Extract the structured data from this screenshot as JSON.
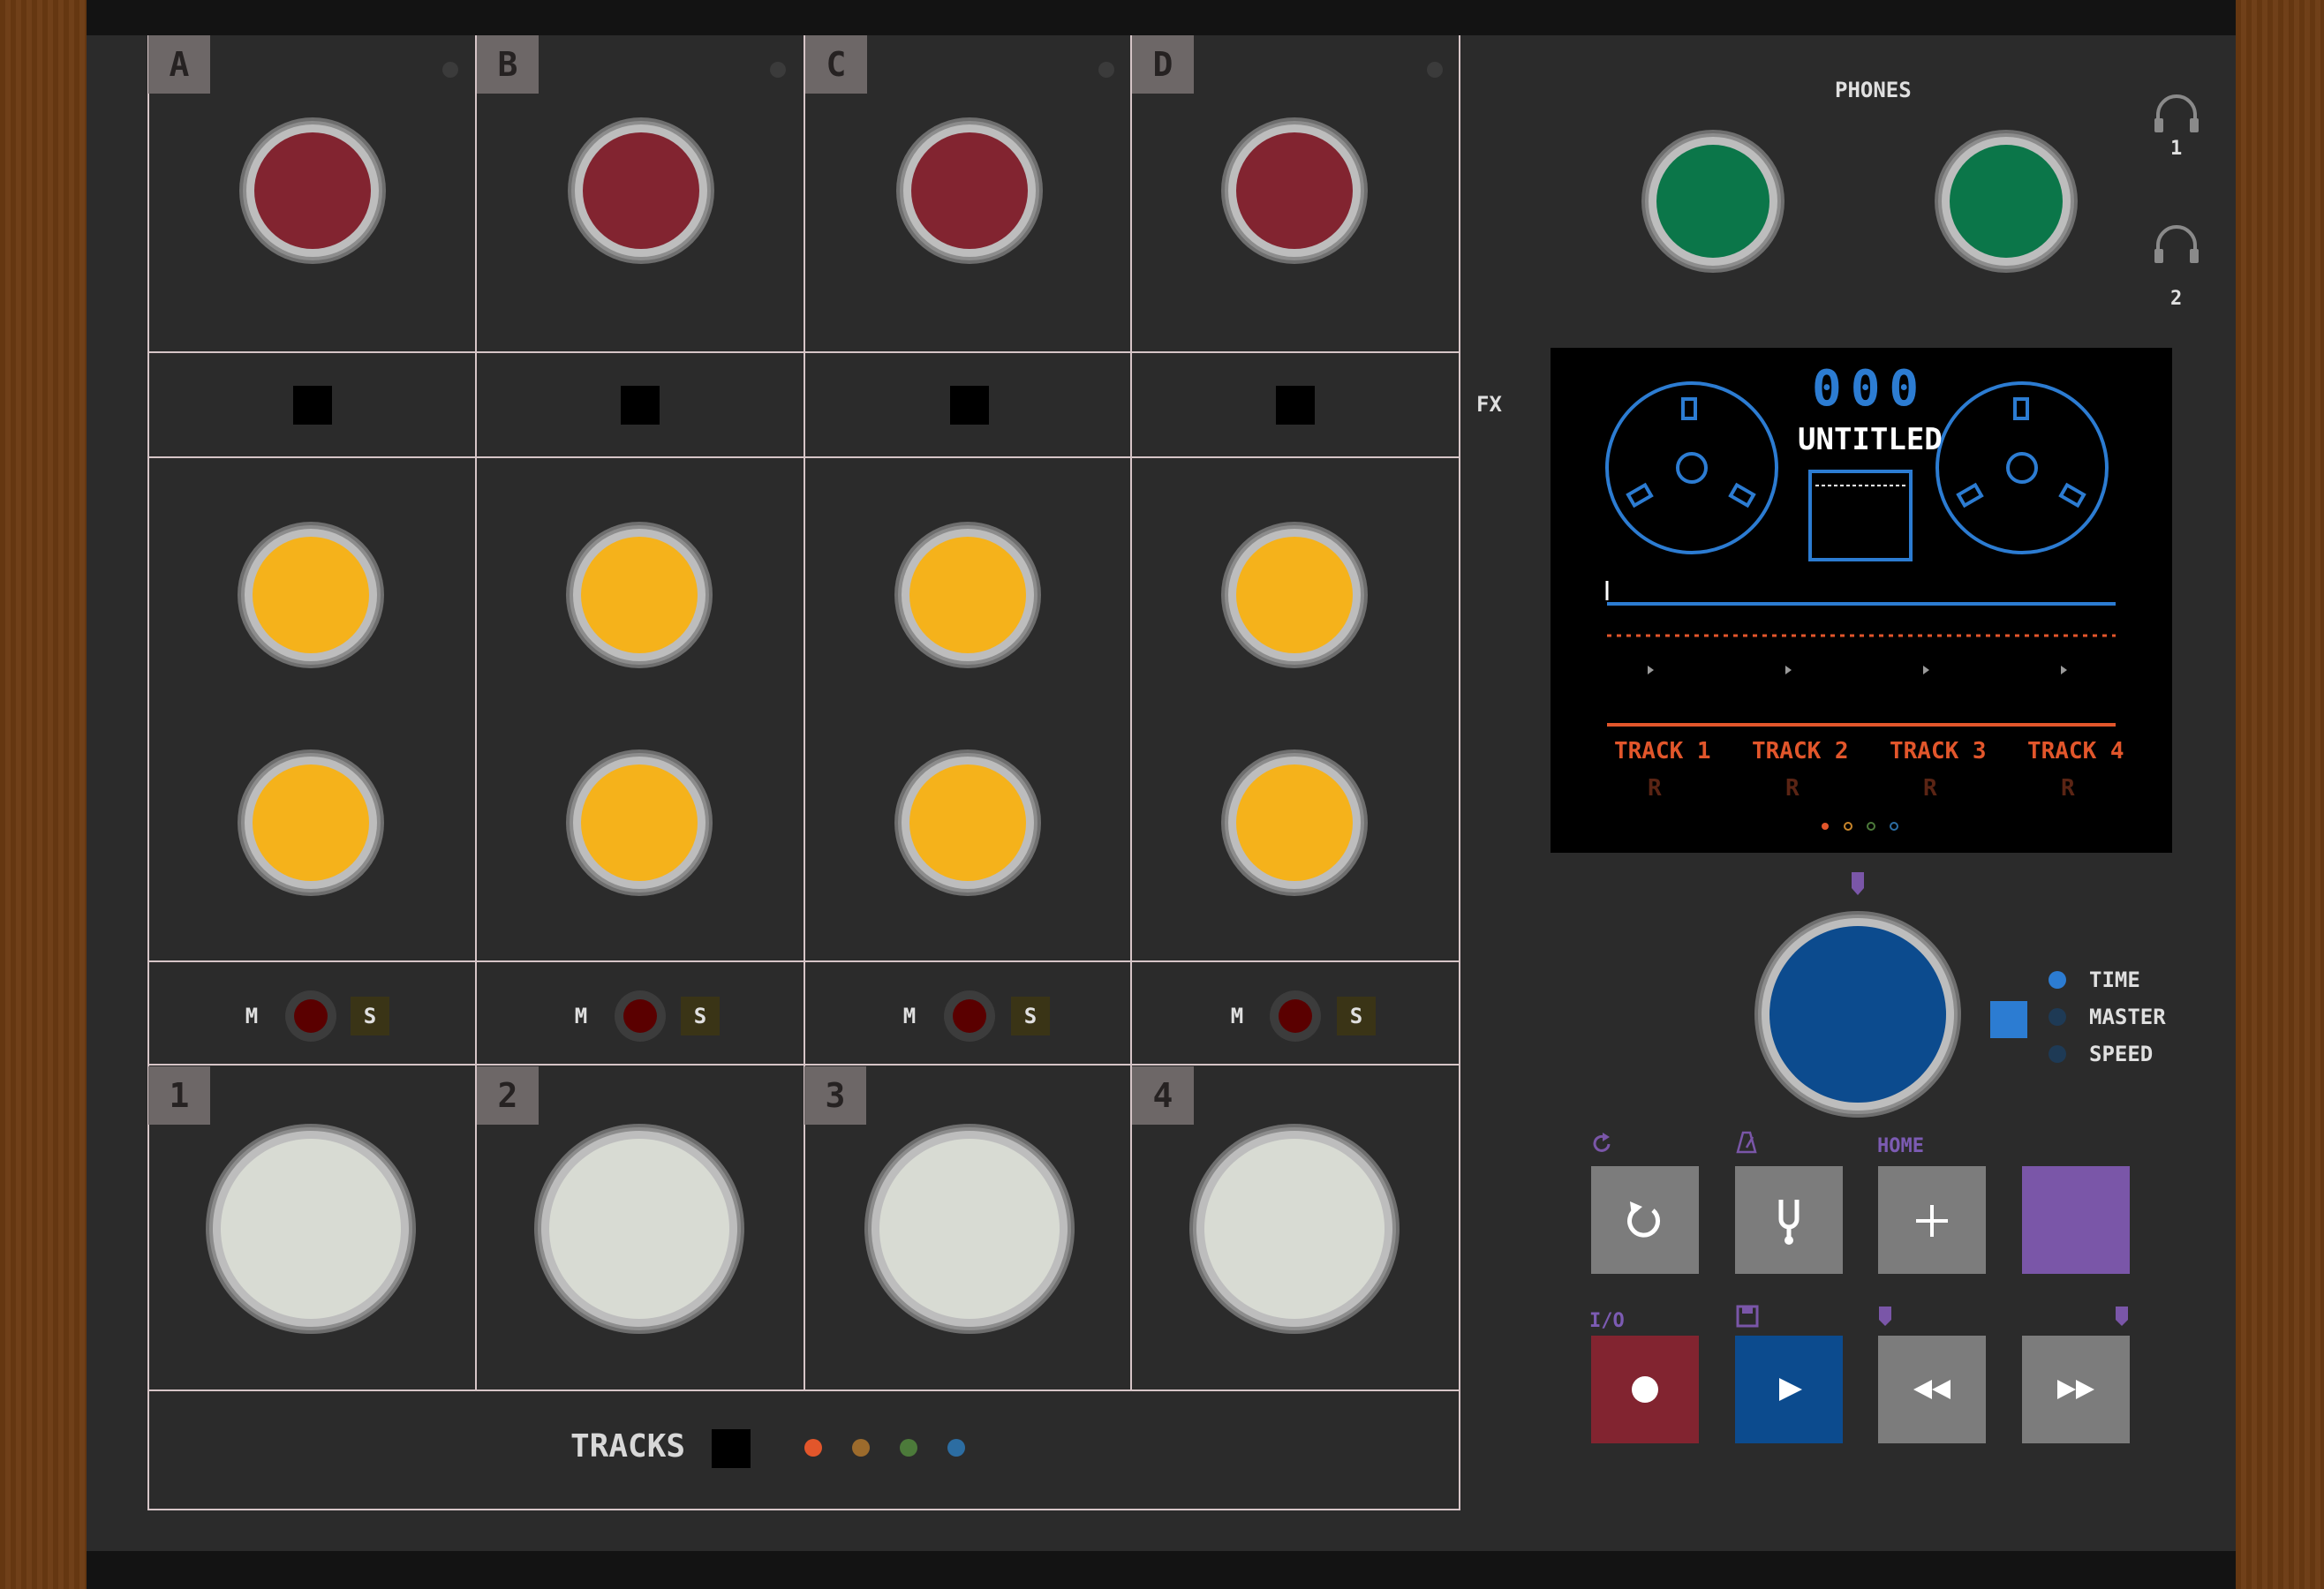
{
  "channels": [
    {
      "label": "A",
      "track_num": "1",
      "mute": "M",
      "solo": "S"
    },
    {
      "label": "B",
      "track_num": "2",
      "mute": "M",
      "solo": "S"
    },
    {
      "label": "C",
      "track_num": "3",
      "mute": "M",
      "solo": "S"
    },
    {
      "label": "D",
      "track_num": "4",
      "mute": "M",
      "solo": "S"
    }
  ],
  "fx_label": "FX",
  "phones_label": "PHONES",
  "headphone_numbers": [
    "1",
    "2"
  ],
  "tracks_label": "TRACKS",
  "track_dot_colors": [
    "#e2562b",
    "#9c6b2c",
    "#4c7a3a",
    "#2c6da2"
  ],
  "display": {
    "counter": "000",
    "title": "UNTITLED",
    "tracks": [
      {
        "name": "TRACK 1",
        "arm": "R"
      },
      {
        "name": "TRACK 2",
        "arm": "R"
      },
      {
        "name": "TRACK 3",
        "arm": "R"
      },
      {
        "name": "TRACK 4",
        "arm": "R"
      }
    ]
  },
  "mode_options": [
    {
      "label": "TIME",
      "active": true
    },
    {
      "label": "MASTER",
      "active": false
    },
    {
      "label": "SPEED",
      "active": false
    }
  ],
  "transport": {
    "home_label": "HOME",
    "io_label": "I/O"
  },
  "colors": {
    "gain_knob": "#822430",
    "eq_knob": "#f5b21b",
    "fader_knob": "#d8dbd3",
    "phones_knob": "#0b7649",
    "main_knob": "#0c4b8e",
    "accent_purple": "#7a56a8",
    "record_button": "#822430",
    "play_button": "#0c4b8e",
    "grey_button": "#7c7c7c",
    "display_blue": "#2c7cd2",
    "display_orange": "#e2562b"
  }
}
